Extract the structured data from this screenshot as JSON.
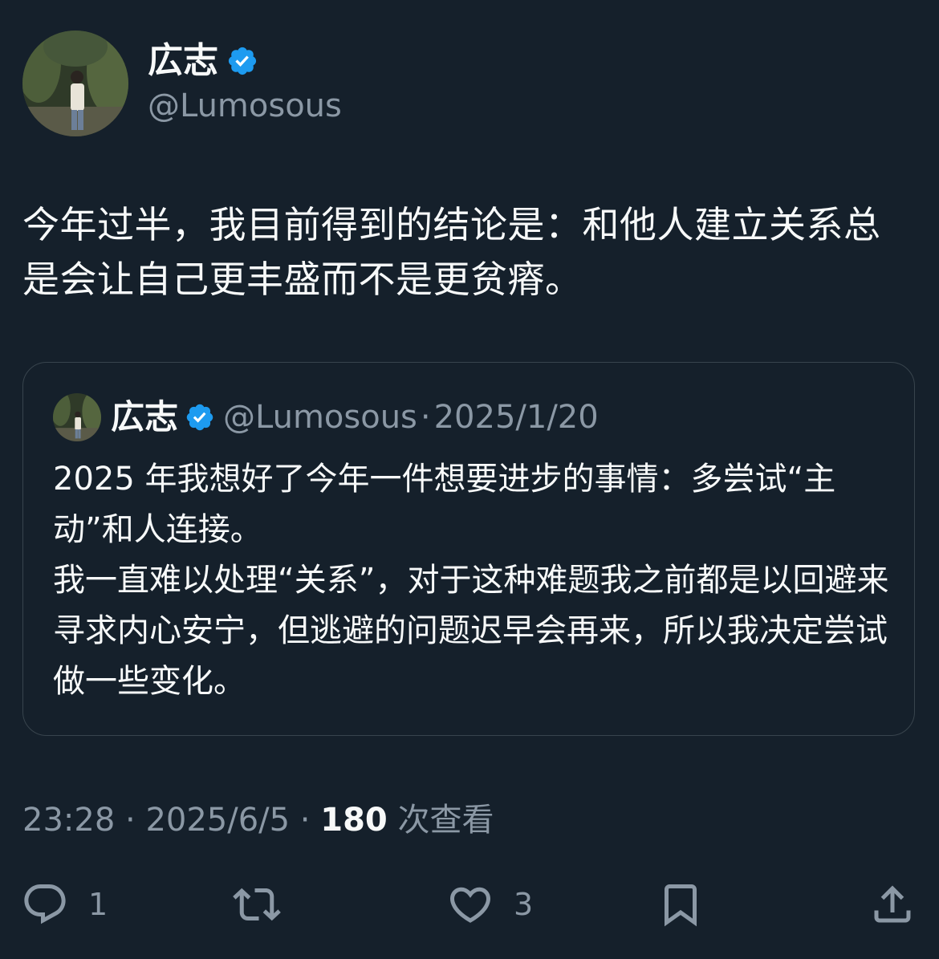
{
  "author": {
    "display_name": "広志",
    "handle": "@Lumosous",
    "verified": true
  },
  "tweet": {
    "text": "今年过半，我目前得到的结论是：和他人建立关系总是会让自己更丰盛而不是更贫瘠。"
  },
  "quote": {
    "display_name": "広志",
    "handle": "@Lumosous",
    "separator": "·",
    "date": "2025/1/20",
    "text": "2025 年我想好了今年一件想要进步的事情：多尝试“主动”和人连接。\n我一直难以处理“关系”，对于这种难题我之前都是以回避来寻求内心安宁，但逃避的问题迟早会再来，所以我决定尝试做一些变化。"
  },
  "meta": {
    "time": "23:28",
    "separator": " · ",
    "date": "2025/6/5",
    "views_count": "180",
    "views_label": "次查看"
  },
  "actions": {
    "reply_count": "1",
    "retweet_count": "",
    "like_count": "3"
  },
  "colors": {
    "background": "#15202b",
    "verified": "#1d9bf0",
    "secondary_text": "#8b98a5",
    "border": "#38444d"
  }
}
